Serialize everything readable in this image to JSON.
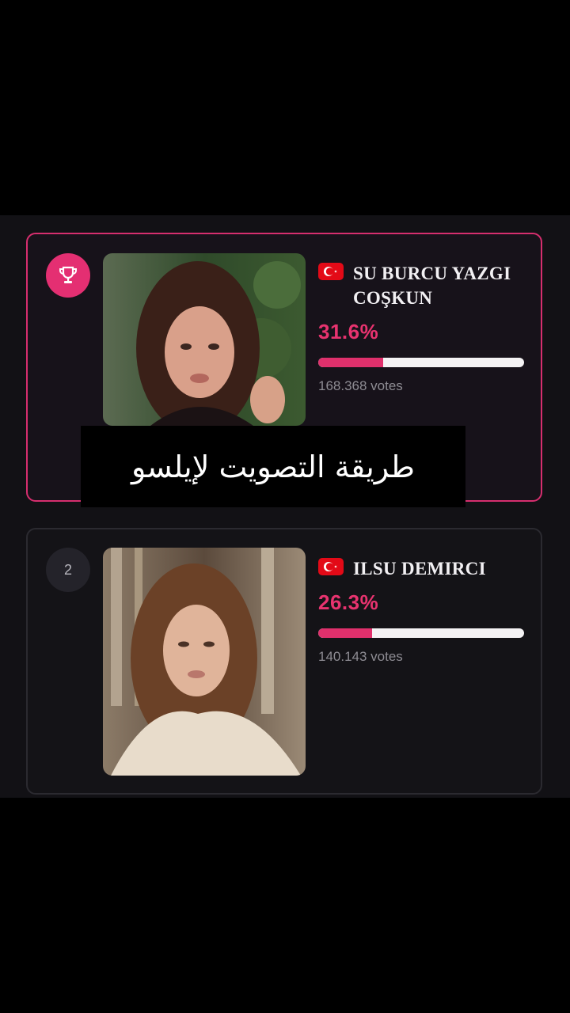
{
  "colors": {
    "accent": "#e42f72",
    "bar_track": "#f4f2f4",
    "bar_fill": "#e0306c",
    "flag": "#e30a17"
  },
  "rankings": [
    {
      "rank": "",
      "badge_icon": "trophy-icon",
      "flag_icon": "turkey-flag-icon",
      "name": "SU BURCU YAZGI COŞKUN",
      "percent": "31.6%",
      "share": 0.316,
      "votes": "168.368 votes"
    },
    {
      "rank": "2",
      "badge_icon": "",
      "flag_icon": "turkey-flag-icon",
      "name": "ILSU DEMIRCI",
      "percent": "26.3%",
      "share": 0.263,
      "votes": "140.143 votes"
    }
  ],
  "overlay": {
    "caption": "طريقة التصويت لإيلسو"
  }
}
